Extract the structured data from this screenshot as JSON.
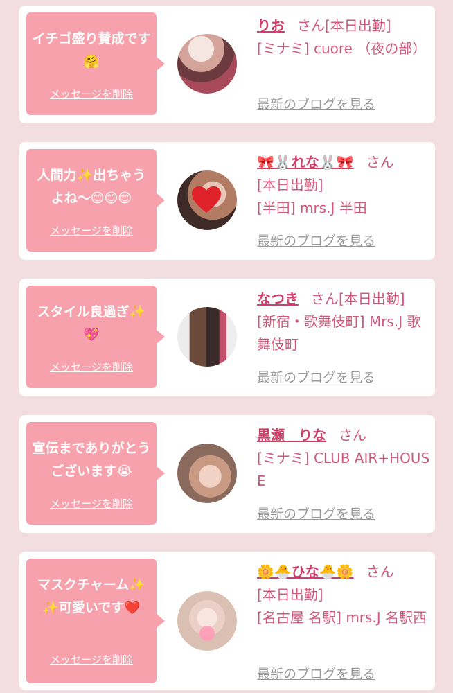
{
  "messages": [
    {
      "bubble_text": "イチゴ盛り賛成です🤗",
      "delete_label": "メッセージを削除",
      "name": "りお",
      "honorific": "さん",
      "status": "[本日出勤]",
      "shop": "[ミナミ] cuore （夜の部）",
      "blog_label": "最新のブログを見る"
    },
    {
      "bubble_text": "人間力✨出ちゃうよね〜😊😊😊",
      "delete_label": "メッセージを削除",
      "name": "🎀🐰れな🐰🎀",
      "honorific": "さん",
      "status": "[本日出勤]",
      "shop": "[半田] mrs.J 半田",
      "blog_label": "最新のブログを見る"
    },
    {
      "bubble_text": "スタイル良過ぎ✨💖",
      "delete_label": "メッセージを削除",
      "name": "なつき",
      "honorific": "さん",
      "status": "[本日出勤]",
      "shop": "[新宿・歌舞伎町] Mrs.J 歌舞伎町",
      "blog_label": "最新のブログを見る"
    },
    {
      "bubble_text": "宣伝までありがとうございます😭",
      "delete_label": "メッセージを削除",
      "name": "黒瀬　りな",
      "honorific": "さん",
      "status": "",
      "shop": "[ミナミ] CLUB AIR+HOUSE",
      "blog_label": "最新のブログを見る"
    },
    {
      "bubble_text": "マスクチャーム✨✨可愛いです❤️",
      "delete_label": "メッセージを削除",
      "name": "🌼🐣ひな🐣🌼",
      "honorific": "さん",
      "status": "[本日出勤]",
      "shop": "[名古屋 名駅] mrs.J 名駅西",
      "blog_label": "最新のブログを見る"
    }
  ],
  "colors": {
    "background": "#f2dee0",
    "bubble": "#f7a1ad",
    "name": "#d23d6a",
    "info": "#d05a7c",
    "blog_link": "#9a9a9a"
  }
}
